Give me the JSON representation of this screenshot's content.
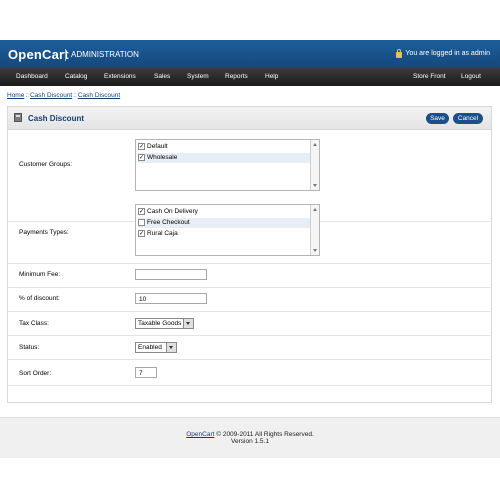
{
  "header": {
    "logo": "OpenCart",
    "subtitle": "ADMINISTRATION",
    "login_text": "You are logged in as admin"
  },
  "menu": {
    "dashboard": "Dashboard",
    "catalog": "Catalog",
    "extensions": "Extensions",
    "sales": "Sales",
    "system": "System",
    "reports": "Reports",
    "help": "Help",
    "store_front": "Store Front",
    "logout": "Logout"
  },
  "breadcrumb": {
    "home": "Home",
    "sep": "::",
    "item1": "Cash Discount",
    "item2": "Cash Discount"
  },
  "page": {
    "title": "Cash Discount",
    "save": "Save",
    "cancel": "Cancel"
  },
  "form": {
    "customer_groups": {
      "label": "Customer Groups:",
      "options": [
        {
          "label": "Default",
          "checked": true
        },
        {
          "label": "Wholesale",
          "checked": true
        }
      ]
    },
    "payment_types": {
      "label": "Payments Types:",
      "options": [
        {
          "label": "Cash On Delivery",
          "checked": true
        },
        {
          "label": "Free Checkout",
          "checked": false
        },
        {
          "label": "Rural Caja",
          "checked": true
        }
      ]
    },
    "minimum_fee": {
      "label": "Minimum Fee:",
      "value": ""
    },
    "discount": {
      "label": "% of discount:",
      "value": "10"
    },
    "tax_class": {
      "label": "Tax Class:",
      "value": "Taxable Goods"
    },
    "status": {
      "label": "Status:",
      "value": "Enabled"
    },
    "sort_order": {
      "label": "Sort Order:",
      "value": "7"
    }
  },
  "footer": {
    "link": "OpenCart",
    "copyright": " © 2009-2011 All Rights Reserved.",
    "version": "Version 1.5.1"
  }
}
